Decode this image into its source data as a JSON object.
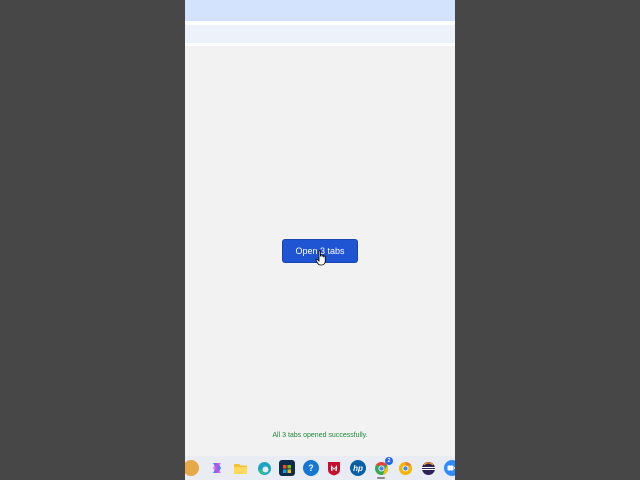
{
  "main": {
    "open_button_label": "Open 3 tabs",
    "status_message": "All 3 tabs opened successfully."
  },
  "taskbar": {
    "icons": [
      "widgets-icon",
      "copilot-icon",
      "file-explorer-icon",
      "edge-browser-icon",
      "microsoft-store-icon",
      "help-icon",
      "mcafee-icon",
      "hp-icon",
      "chrome-icon",
      "chrome-canary-icon",
      "eclipse-icon",
      "zoom-icon"
    ],
    "chrome_badge": "2"
  },
  "colors": {
    "button": "#1f54d3",
    "status_text": "#1e8a3a",
    "title_bar": "#d3e3fd",
    "page_background": "#f2f2f2"
  }
}
